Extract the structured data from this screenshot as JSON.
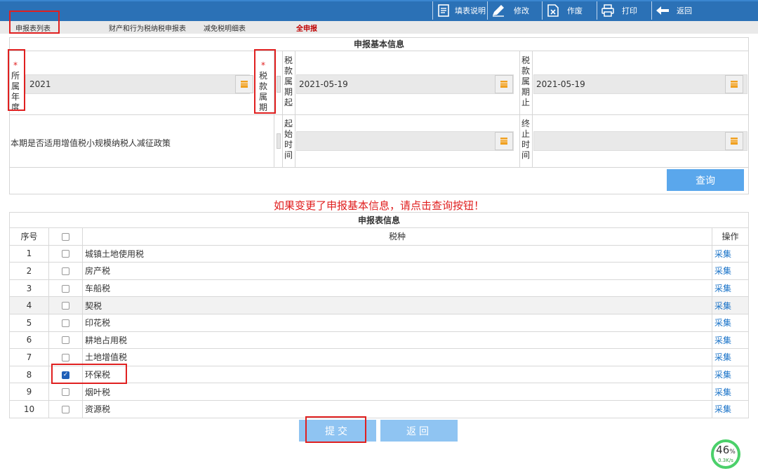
{
  "toolbar": {
    "fill_help": "填表说明",
    "edit": "修改",
    "void": "作废",
    "print": "打印",
    "back": "返回"
  },
  "tabs": {
    "list": "申报表列表",
    "property": "财产和行为税纳税申报表",
    "reduction": "减免税明细表",
    "all": "全申报"
  },
  "basic": {
    "title": "申报基本信息",
    "year_label": "所属年度",
    "year_value": "2021",
    "period_label": "税款属期",
    "start_label": "税款属期起",
    "start_value": "2021-05-19",
    "end_label": "税款属期止",
    "end_value": "2021-05-19",
    "policy_label": "本期是否适用增值税小规模纳税人减征政策",
    "start_time_label": "起始时间",
    "end_time_label": "终止时间",
    "query": "查询"
  },
  "warning": "如果变更了申报基本信息，请点击查询按钮！",
  "table": {
    "title": "申报表信息",
    "col_seq": "序号",
    "col_tax": "税种",
    "col_op": "操作",
    "rows": [
      {
        "seq": "1",
        "tax": "城镇土地使用税",
        "op": "采集",
        "checked": false
      },
      {
        "seq": "2",
        "tax": "房产税",
        "op": "采集",
        "checked": false
      },
      {
        "seq": "3",
        "tax": "车船税",
        "op": "采集",
        "checked": false
      },
      {
        "seq": "4",
        "tax": "契税",
        "op": "采集",
        "checked": false
      },
      {
        "seq": "5",
        "tax": "印花税",
        "op": "采集",
        "checked": false
      },
      {
        "seq": "6",
        "tax": "耕地占用税",
        "op": "采集",
        "checked": false
      },
      {
        "seq": "7",
        "tax": "土地增值税",
        "op": "采集",
        "checked": false
      },
      {
        "seq": "8",
        "tax": "环保税",
        "op": "采集",
        "checked": true
      },
      {
        "seq": "9",
        "tax": "烟叶税",
        "op": "采集",
        "checked": false
      },
      {
        "seq": "10",
        "tax": "资源税",
        "op": "采集",
        "checked": false
      }
    ]
  },
  "buttons": {
    "submit": "提交",
    "back": "返回"
  },
  "speed": {
    "percent": "46",
    "unit": "%",
    "rate": "0.3K/s"
  }
}
